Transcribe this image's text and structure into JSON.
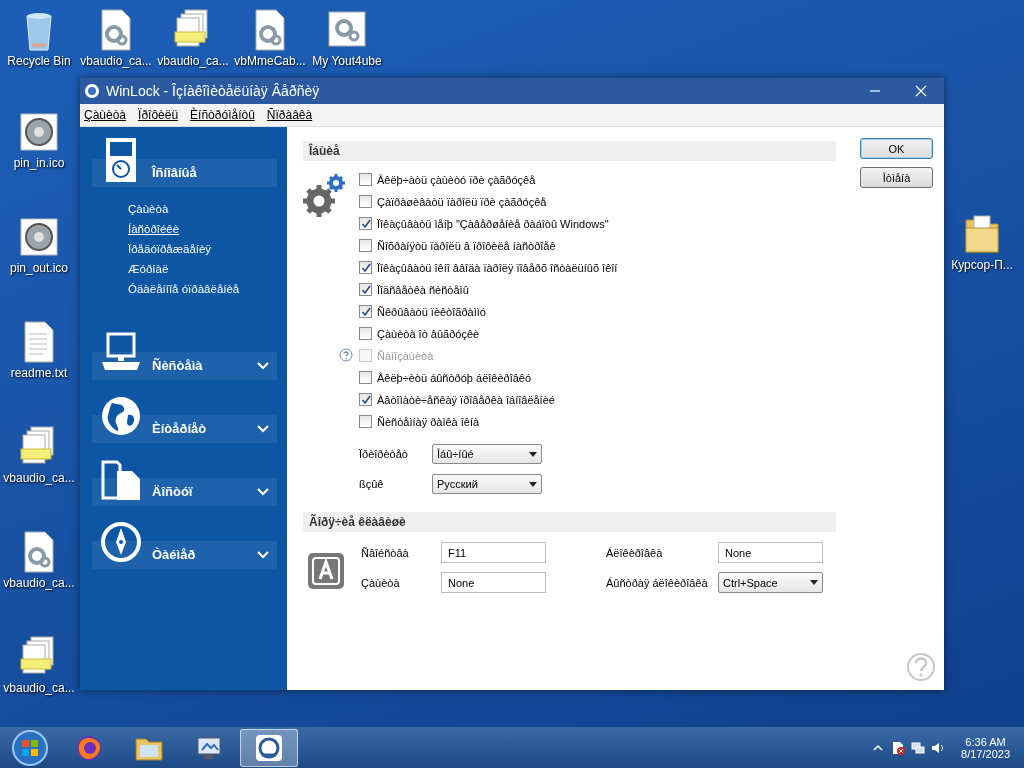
{
  "desktop": {
    "top_row": [
      {
        "label": "Recycle Bin",
        "kind": "bin"
      },
      {
        "label": "vbaudio_ca...",
        "kind": "gearfile"
      },
      {
        "label": "vbaudio_ca...",
        "kind": "stack"
      },
      {
        "label": "vbMmeCab...",
        "kind": "gearfile"
      },
      {
        "label": "My Yout4ube",
        "kind": "app"
      }
    ],
    "left_column": [
      {
        "label": "pin_in.ico",
        "kind": "disk"
      },
      {
        "label": "pin_out.ico",
        "kind": "disk"
      },
      {
        "label": "readme.txt",
        "kind": "text"
      },
      {
        "label": "vbaudio_ca...",
        "kind": "stack"
      },
      {
        "label": "vbaudio_ca...",
        "kind": "gearfile"
      },
      {
        "label": "vbaudio_ca...",
        "kind": "stack"
      }
    ],
    "right_column": [
      {
        "label": "Курсор-П...",
        "kind": "folder"
      }
    ]
  },
  "window": {
    "title": "WinLock - Îçíàêîìèòåëüíàÿ Âåðñèÿ",
    "menu": [
      "Çàùèòà",
      "Ïðîôèëü",
      "Èíñòðóìåíòû",
      "Ñïðàâêà"
    ],
    "sidebar": [
      {
        "label": "Îñíîâíûå",
        "kind": "player",
        "expanded": true,
        "children": [
          {
            "label": "Çàùèòà",
            "selected": false
          },
          {
            "label": "Íàñòðîéêè",
            "selected": true
          },
          {
            "label": "Ïðåäóïðåæäåíèÿ",
            "selected": false
          },
          {
            "label": "Æóðíàë",
            "selected": false
          },
          {
            "label": "Óäàëåííîå óïðàâëåíèå",
            "selected": false
          }
        ]
      },
      {
        "label": "Ñèñòåìà",
        "kind": "computer",
        "expanded": false
      },
      {
        "label": "Èíòåðíåò",
        "kind": "globe",
        "expanded": false
      },
      {
        "label": "Äîñòóï",
        "kind": "files",
        "expanded": false
      },
      {
        "label": "Òàéìåð",
        "kind": "compass",
        "expanded": false
      }
    ],
    "general": {
      "title": "Îáùèå",
      "options": [
        {
          "label": "Âêëþ÷àòü çàùèòó ïðè çàãðóçêå",
          "checked": false,
          "disabled": false,
          "help": false
        },
        {
          "label": "Çàïðàøèâàòü ïàðîëü ïðè çàãðóçêå",
          "checked": false,
          "disabled": false,
          "help": false
        },
        {
          "label": "Ïîêàçûâàòü ìåíþ \"Çàâåðøåíèå ðàáîòû Windows\"",
          "checked": true,
          "disabled": false,
          "help": false
        },
        {
          "label": "Ñîõðàíÿòü ïàðîëü â ïðîôèëå íàñòðîåê",
          "checked": false,
          "disabled": false,
          "help": false
        },
        {
          "label": "Ïîêàçûâàòü îêíî ââîäà ïàðîëÿ ïîâåðõ îñòàëüíûõ îêîí",
          "checked": true,
          "disabled": false,
          "help": false
        },
        {
          "label": "Ïîäñâåòêà ñèñòåìû",
          "checked": true,
          "disabled": false,
          "help": false
        },
        {
          "label": "Ñêðûâàòü ïèêòîãðàììó",
          "checked": true,
          "disabled": false,
          "help": false
        },
        {
          "label": "Çàùèòà îò âûãðóçêè",
          "checked": false,
          "disabled": false,
          "help": false
        },
        {
          "label": "Ñàìîçàùèòà",
          "checked": false,
          "disabled": true,
          "help": true
        },
        {
          "label": "Âêëþ÷èòü áûñòðóþ áëîêèðîâêó",
          "checked": false,
          "disabled": false,
          "help": false
        },
        {
          "label": "Àâòîìàòè÷åñêàÿ ïðîâåðêà îáíîâëåíèé",
          "checked": true,
          "disabled": false,
          "help": false
        },
        {
          "label": "Ñèñòåìíàÿ ðàìêà îêíà",
          "checked": false,
          "disabled": false,
          "help": false
        }
      ],
      "selects": [
        {
          "label": "Ïðèîðèòåò",
          "value": "Îáû÷íûé"
        },
        {
          "label": "ßçûê",
          "value": "Русский"
        }
      ]
    },
    "hotkeys": {
      "title": "Ãîðÿ÷èå êëàâèøè",
      "fields": [
        {
          "label": "Ñâîéñòâà",
          "value": "F11",
          "kind": "input"
        },
        {
          "label": "Áëîêèðîâêà",
          "value": "None",
          "kind": "input"
        },
        {
          "label": "Çàùèòà",
          "value": "None",
          "kind": "input"
        },
        {
          "label": "Áûñòðàÿ áëîêèðîâêà",
          "value": "Ctrl+Space",
          "kind": "select"
        }
      ]
    },
    "buttons": [
      "OK",
      "Îòìåíà"
    ]
  },
  "taskbar": {
    "apps": [
      {
        "kind": "browser",
        "active": false
      },
      {
        "kind": "explorer",
        "active": false
      },
      {
        "kind": "monitor",
        "active": false
      },
      {
        "kind": "winlock",
        "active": true
      }
    ],
    "time": "6:36 AM",
    "date": "8/17/2023"
  }
}
